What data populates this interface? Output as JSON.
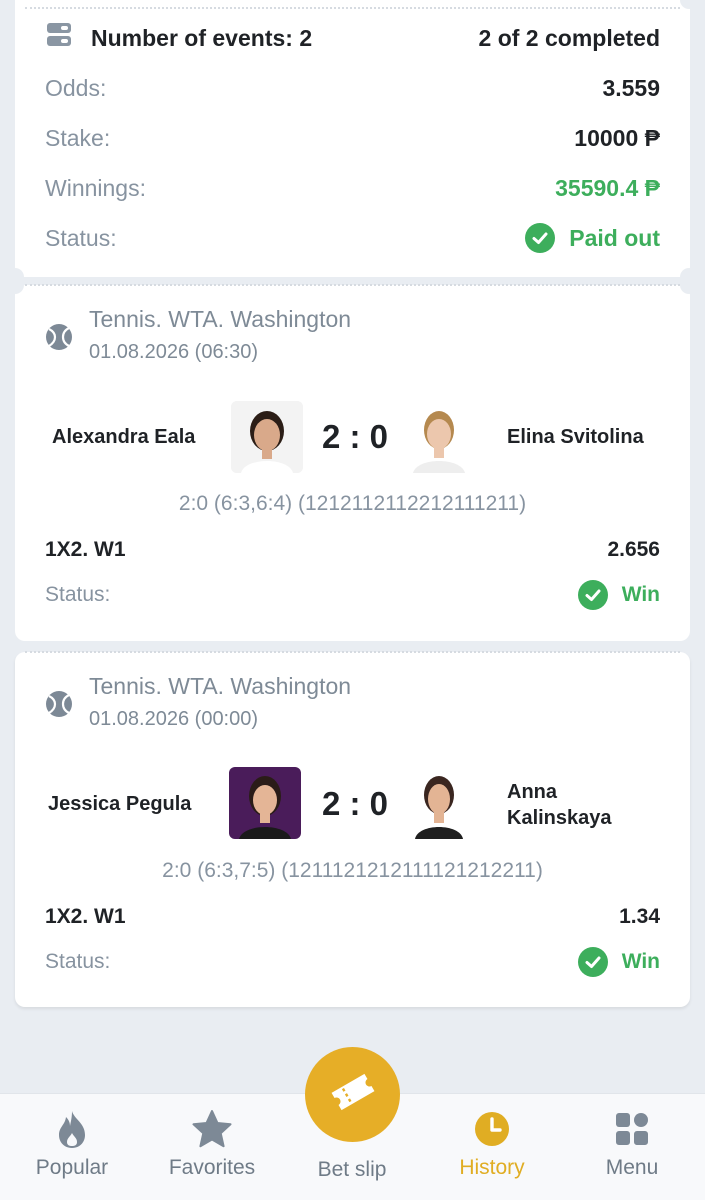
{
  "summary": {
    "events_label": "Number of events: 2",
    "completed": "2 of 2 completed",
    "odds_label": "Odds:",
    "odds_value": "3.559",
    "stake_label": "Stake:",
    "stake_value": "10000 ₱",
    "winnings_label": "Winnings:",
    "winnings_value": "35590.4 ₱",
    "status_label": "Status:",
    "status_value": "Paid out"
  },
  "events": [
    {
      "league": "Tennis. WTA. Washington",
      "date": "01.08.2026 (06:30)",
      "player1": "Alexandra Eala",
      "player2": "Elina Svitolina",
      "score": "2 : 0",
      "detail": "2:0 (6:3,6:4) (1212112112212111211)",
      "bet": "1X2. W1",
      "odds": "2.656",
      "status_label": "Status:",
      "status_value": "Win"
    },
    {
      "league": "Tennis. WTA. Washington",
      "date": "01.08.2026 (00:00)",
      "player1": "Jessica Pegula",
      "player2_line1": "Anna",
      "player2_line2": "Kalinskaya",
      "score": "2 : 0",
      "detail": "2:0 (6:3,7:5) (1211121212111121212211)",
      "bet": "1X2. W1",
      "odds": "1.34",
      "status_label": "Status:",
      "status_value": "Win"
    }
  ],
  "nav": {
    "popular": "Popular",
    "favorites": "Favorites",
    "betslip": "Bet slip",
    "history": "History",
    "menu": "Menu"
  },
  "colors": {
    "accent": "#e6ae27",
    "success": "#3dae5c",
    "background": "#e9edf2"
  }
}
